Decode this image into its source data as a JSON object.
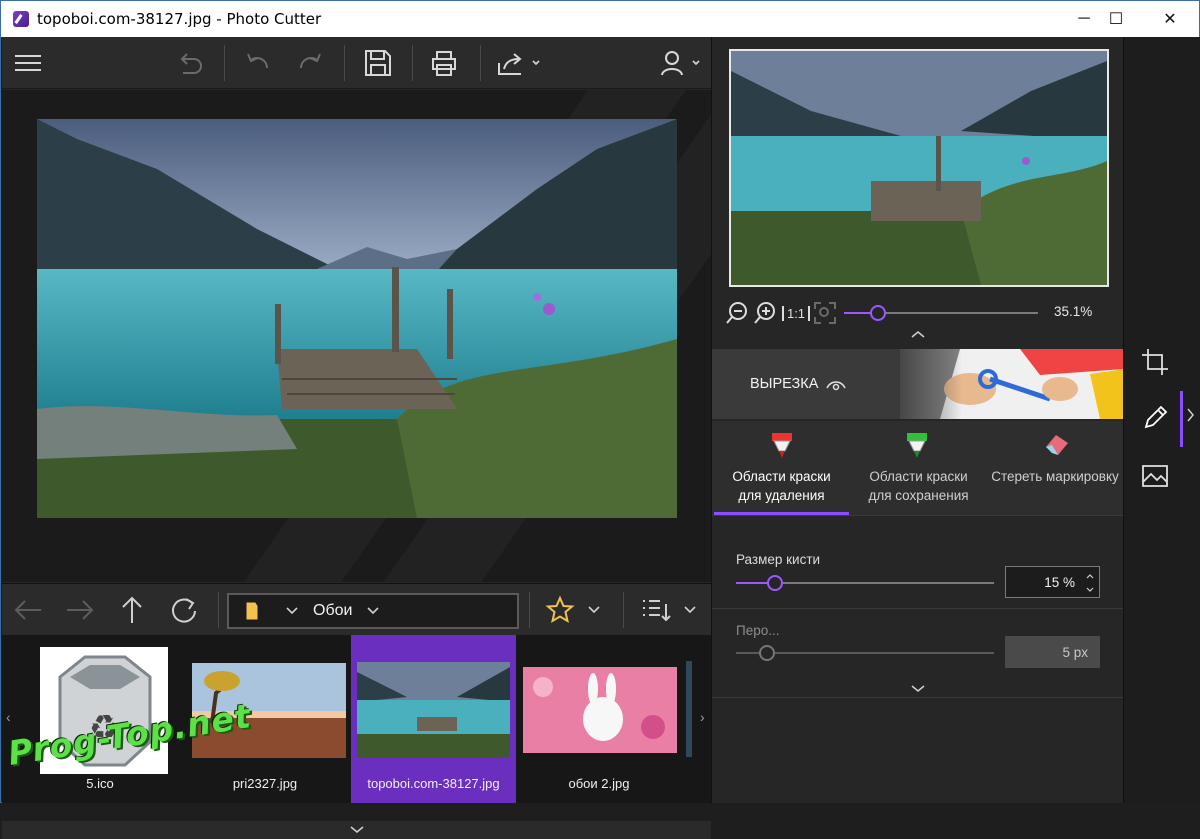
{
  "window": {
    "title": "topoboi.com-38127.jpg - Photo Cutter"
  },
  "controls": {
    "minimize": "─",
    "maximize": "☐",
    "close": "✕"
  },
  "nav": {
    "folder": "Обои"
  },
  "thumbnails": [
    {
      "name": "5.ico",
      "selected": false
    },
    {
      "name": "pri2327.jpg",
      "selected": false
    },
    {
      "name": "topoboi.com-38127.jpg",
      "selected": true
    },
    {
      "name": "обои 2.jpg",
      "selected": false
    }
  ],
  "zoom": {
    "value": "35.1%",
    "fit_label": "1:1",
    "level": 0.351
  },
  "section": {
    "title": "ВЫРЕЗКА"
  },
  "tools": {
    "remove_line1": "Области краски",
    "remove_line2": "для удаления",
    "keep_line1": "Области краски",
    "keep_line2": "для сохранения",
    "erase": "Стереть маркировку"
  },
  "brush": {
    "label": "Размер кисти",
    "value": "15 %",
    "level": 0.15
  },
  "feather": {
    "label": "Перо...",
    "value": "5 px",
    "level": 0.12
  },
  "watermark": "Prog-Top.net",
  "colors": {
    "accent": "#8a4dff",
    "selected_thumb": "#6b2fbf",
    "brand_green": "#5de04a"
  }
}
